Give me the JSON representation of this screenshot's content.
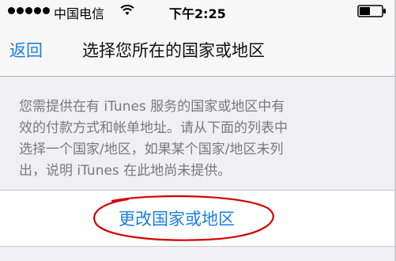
{
  "status_bar": {
    "carrier": "中国电信",
    "time": "下午2:25",
    "signal_dots": 5,
    "wifi_icon": "wifi-icon",
    "battery_icon": "battery-icon"
  },
  "nav": {
    "back_label": "返回",
    "title": "选择您所在的国家或地区"
  },
  "description": {
    "lines": [
      "您需提供在有 iTunes 服务的国家或地区中有",
      "效的付款方式和帐单地址。请从下面的列表中",
      "选择一个国家/地区，如果某个国家/地区未列",
      "出，说明 iTunes 在此地尚未提供。"
    ]
  },
  "action": {
    "change_country_label": "更改国家或地区"
  },
  "colors": {
    "accent": "#1a7ee0",
    "annotation": "#d40000",
    "background": "#efeff4"
  }
}
